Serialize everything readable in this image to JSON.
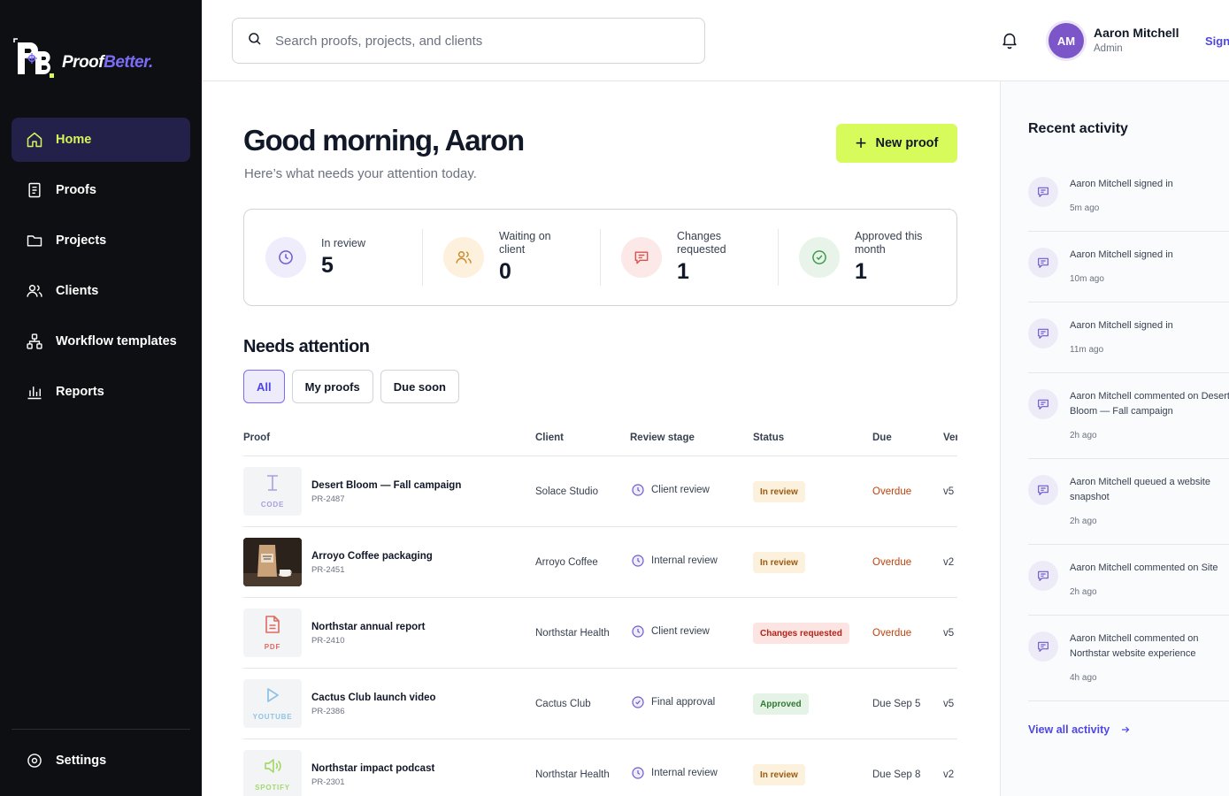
{
  "brand": {
    "name_part1": "Proof",
    "name_part2": "Better."
  },
  "nav": {
    "items": [
      {
        "label": "Home",
        "icon": "home-icon",
        "active": true
      },
      {
        "label": "Proofs",
        "icon": "document-icon"
      },
      {
        "label": "Projects",
        "icon": "folder-icon"
      },
      {
        "label": "Clients",
        "icon": "users-icon"
      },
      {
        "label": "Workflow templates",
        "icon": "workflow-icon"
      },
      {
        "label": "Reports",
        "icon": "bar-chart-icon"
      }
    ],
    "settings_label": "Settings"
  },
  "topbar": {
    "search_placeholder": "Search proofs, projects, and clients",
    "user_initials": "AM",
    "user_name": "Aaron Mitchell",
    "user_role": "Admin",
    "signout_label": "Sign out"
  },
  "main": {
    "greeting": "Good morning, Aaron",
    "subtitle": "Here’s what needs your attention today.",
    "new_proof_label": "New proof",
    "stats": [
      {
        "label": "In review",
        "value": "5",
        "icon": "clock-icon",
        "color": "#6d5bd0",
        "bg": "#efecfb"
      },
      {
        "label": "Waiting on client",
        "value": "0",
        "icon": "users-icon",
        "color": "#c98a2b",
        "bg": "#fdf1de"
      },
      {
        "label": "Changes requested",
        "value": "1",
        "icon": "comment-icon",
        "color": "#d9534f",
        "bg": "#fce8e6"
      },
      {
        "label": "Approved this month",
        "value": "1",
        "icon": "check-circle-icon",
        "color": "#3f9a4b",
        "bg": "#e8f4ea"
      }
    ],
    "needs_attention_title": "Needs attention",
    "filters": [
      {
        "label": "All",
        "active": true
      },
      {
        "label": "My proofs"
      },
      {
        "label": "Due soon"
      }
    ],
    "table": {
      "headers": {
        "proof": "Proof",
        "client": "Client",
        "stage": "Review stage",
        "status": "Status",
        "due": "Due",
        "version": "Version"
      },
      "rows": [
        {
          "name": "Desert Bloom — Fall campaign",
          "id": "PR-2487",
          "thumb": "code",
          "thumb_tag": "CODE",
          "client": "Solace Studio",
          "stage": "Client review",
          "stage_icon": "clock-icon",
          "status": "In review",
          "status_type": "review",
          "due": "Overdue",
          "due_type": "overdue",
          "version": "v5"
        },
        {
          "name": "Arroyo Coffee packaging",
          "id": "PR-2451",
          "thumb": "photo",
          "thumb_tag": "",
          "client": "Arroyo Coffee",
          "stage": "Internal review",
          "stage_icon": "clock-icon",
          "status": "In review",
          "status_type": "review",
          "due": "Overdue",
          "due_type": "overdue",
          "version": "v2"
        },
        {
          "name": "Northstar annual report",
          "id": "PR-2410",
          "thumb": "pdf",
          "thumb_tag": "PDF",
          "client": "Northstar Health",
          "stage": "Client review",
          "stage_icon": "clock-icon",
          "status": "Changes requested",
          "status_type": "changes",
          "due": "Overdue",
          "due_type": "overdue",
          "version": "v5"
        },
        {
          "name": "Cactus Club launch video",
          "id": "PR-2386",
          "thumb": "youtube",
          "thumb_tag": "YOUTUBE",
          "client": "Cactus Club",
          "stage": "Final approval",
          "stage_icon": "check-circle-icon",
          "status": "Approved",
          "status_type": "approved",
          "due": "Due Sep 5",
          "due_type": "normal",
          "version": "v5"
        },
        {
          "name": "Northstar impact podcast",
          "id": "PR-2301",
          "thumb": "spotify",
          "thumb_tag": "SPOTIFY",
          "client": "Northstar Health",
          "stage": "Internal review",
          "stage_icon": "clock-icon",
          "status": "In review",
          "status_type": "review",
          "due": "Due Sep 8",
          "due_type": "normal",
          "version": "v2"
        }
      ]
    }
  },
  "activity": {
    "title": "Recent activity",
    "items": [
      {
        "text": "Aaron Mitchell signed in",
        "time": "5m ago"
      },
      {
        "text": "Aaron Mitchell signed in",
        "time": "10m ago"
      },
      {
        "text": "Aaron Mitchell signed in",
        "time": "11m ago"
      },
      {
        "text": "Aaron Mitchell commented on Desert Bloom — Fall campaign",
        "time": "2h ago"
      },
      {
        "text": "Aaron Mitchell queued a website snapshot",
        "time": "2h ago"
      },
      {
        "text": "Aaron Mitchell commented on Site",
        "time": "2h ago"
      },
      {
        "text": "Aaron Mitchell commented on Northstar website experience",
        "time": "4h ago"
      }
    ],
    "view_all_label": "View all activity"
  }
}
